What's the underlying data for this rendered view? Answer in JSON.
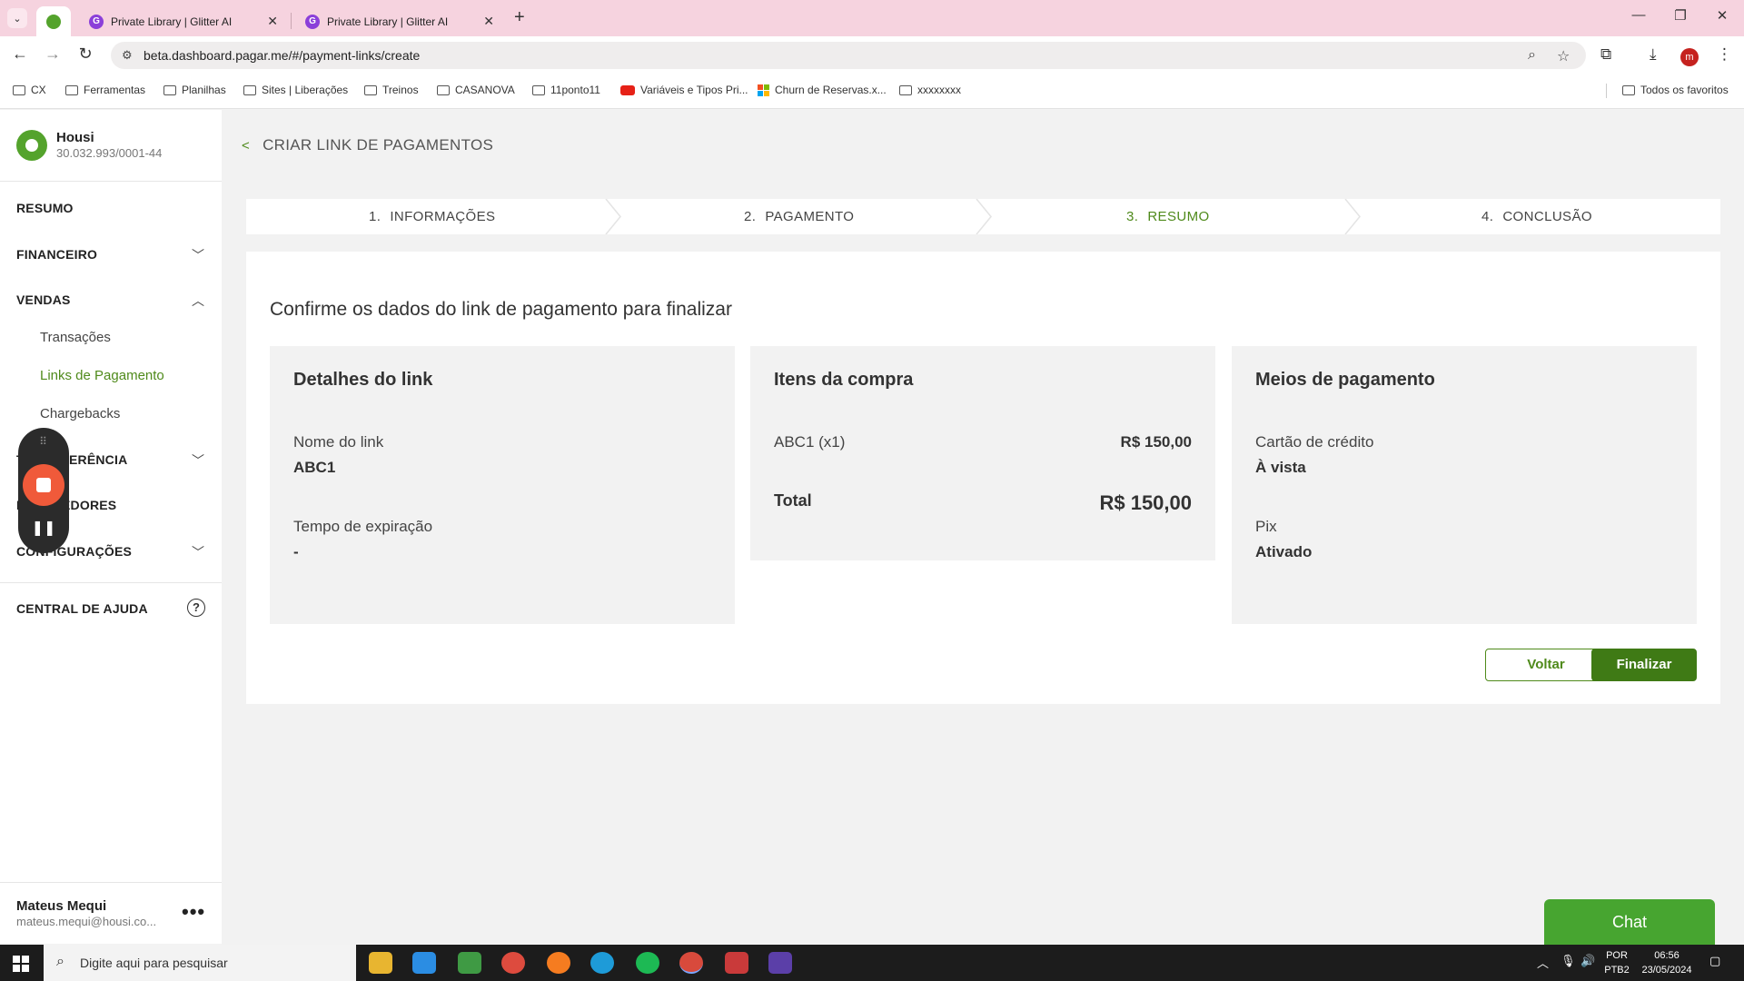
{
  "browser": {
    "tabs": [
      {
        "title": "Private Library | Glitter AI"
      },
      {
        "title": "Private Library | Glitter AI"
      }
    ],
    "url": "beta.dashboard.pagar.me/#/payment-links/create",
    "bookmarks": [
      "CX",
      "Ferramentas",
      "Planilhas",
      "Sites | Liberações",
      "Treinos",
      "CASANOVA",
      "11ponto11",
      "Variáveis e Tipos Pri...",
      "Churn de Reservas.x...",
      "xxxxxxxx"
    ],
    "all_bookmarks": "Todos os favoritos",
    "profile_initial": "m"
  },
  "sidebar": {
    "company": "Housi",
    "document": "30.032.993/0001-44",
    "resumo": "RESUMO",
    "financeiro": "FINANCEIRO",
    "vendas": "VENDAS",
    "vendas_items": [
      "Transações",
      "Links de Pagamento",
      "Chargebacks"
    ],
    "transferencia": "TRANSFERÊNCIA",
    "recebedores": "RECEBEDORES",
    "configuracoes": "CONFIGURAÇÕES",
    "help": "CENTRAL DE AJUDA",
    "user_name": "Mateus Mequi",
    "user_email": "mateus.mequi@housi.co..."
  },
  "page": {
    "back_title": "CRIAR LINK DE PAGAMENTOS",
    "steps": [
      {
        "num": "1.",
        "label": "INFORMAÇÕES"
      },
      {
        "num": "2.",
        "label": "PAGAMENTO"
      },
      {
        "num": "3.",
        "label": "RESUMO"
      },
      {
        "num": "4.",
        "label": "CONCLUSÃO"
      }
    ],
    "active_step": 3,
    "card_title": "Confirme os dados do link de pagamento para finalizar",
    "details": {
      "title": "Detalhes do link",
      "name_label": "Nome do link",
      "name_value": "ABC1",
      "expiration_label": "Tempo de expiração",
      "expiration_value": "-"
    },
    "items": {
      "title": "Itens da compra",
      "item_label": "ABC1 (x1)",
      "item_price": "R$ 150,00",
      "total_label": "Total",
      "total_price": "R$ 150,00"
    },
    "payment": {
      "title": "Meios de pagamento",
      "card_label": "Cartão de crédito",
      "card_value": "À vista",
      "pix_label": "Pix",
      "pix_value": "Ativado"
    },
    "back_button": "Voltar",
    "finish_button": "Finalizar",
    "chat": "Chat"
  },
  "taskbar": {
    "search_placeholder": "Digite aqui para pesquisar",
    "lang": "POR",
    "layout": "PTB2",
    "time": "06:56",
    "date": "23/05/2024"
  },
  "colors": {
    "accent_green": "#4f8a1b",
    "finish_green": "#3f7a15",
    "chat_green": "#47a530",
    "tabbar_pink": "#f6d3df"
  }
}
